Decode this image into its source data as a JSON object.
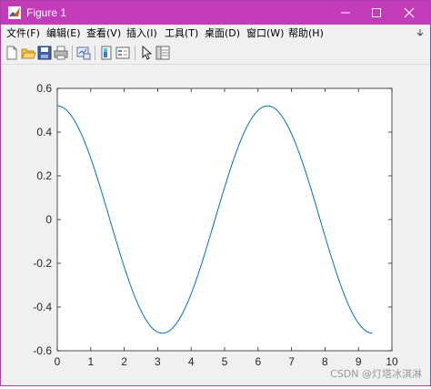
{
  "window": {
    "title": "Figure 1"
  },
  "menu": [
    {
      "label": "文件(F)"
    },
    {
      "label": "编辑(E)"
    },
    {
      "label": "查看(V)"
    },
    {
      "label": "插入(I)"
    },
    {
      "label": "工具(T)"
    },
    {
      "label": "桌面(D)"
    },
    {
      "label": "窗口(W)"
    },
    {
      "label": "帮助(H)"
    }
  ],
  "toolbar": [
    {
      "icon": "new-figure-icon"
    },
    {
      "icon": "open-file-icon"
    },
    {
      "icon": "save-icon"
    },
    {
      "icon": "print-icon"
    },
    {
      "icon": "link-plot-icon"
    },
    {
      "icon": "colorbar-icon"
    },
    {
      "icon": "legend-icon"
    },
    {
      "icon": "edit-plot-icon"
    },
    {
      "icon": "property-inspector-icon"
    }
  ],
  "chart_data": {
    "type": "line",
    "function_shape": "0.52*cos(x)",
    "x_range": [
      0,
      9.42
    ],
    "series": [
      {
        "color": "#0072bd",
        "amplitude": 0.52,
        "x_max": 9.42
      }
    ],
    "xlim": [
      0,
      10
    ],
    "ylim": [
      -0.6,
      0.6
    ],
    "xticks": [
      "0",
      "1",
      "2",
      "3",
      "4",
      "5",
      "6",
      "7",
      "8",
      "9",
      "10"
    ],
    "yticks": [
      "0.6",
      "0.4",
      "0.2",
      "0",
      "-0.2",
      "-0.4",
      "-0.6"
    ],
    "grid": false
  },
  "watermark": "CSDN @灯塔冰淇淋"
}
